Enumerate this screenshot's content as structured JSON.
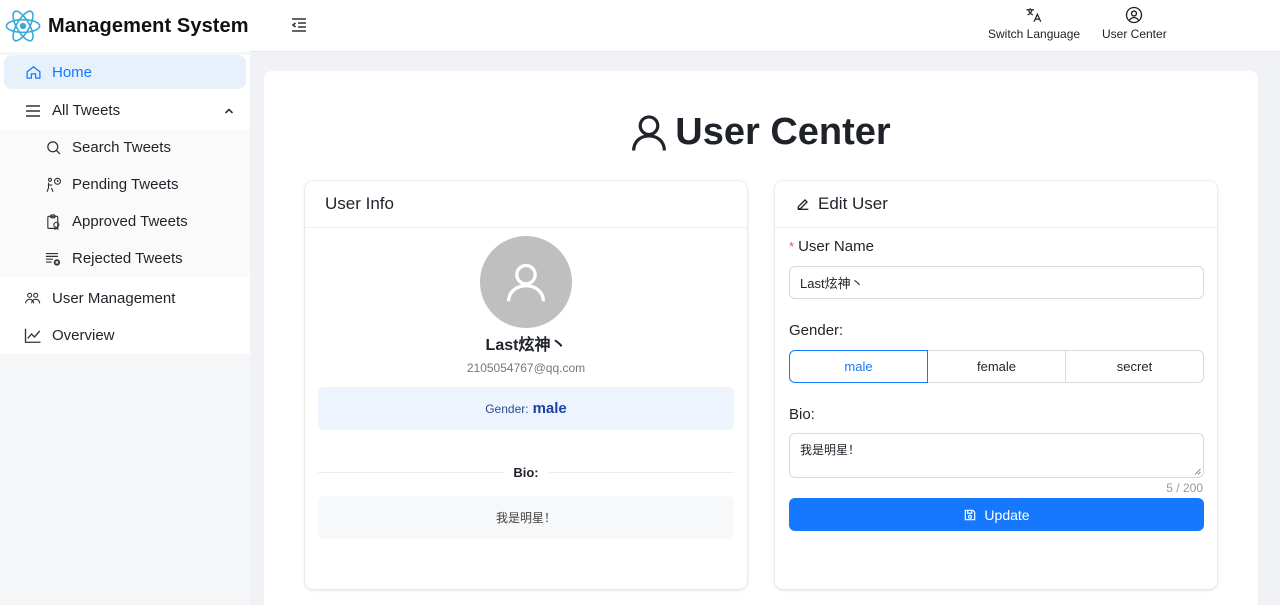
{
  "app": {
    "title": "Management System"
  },
  "sidebar": {
    "items": [
      {
        "label": "Home",
        "icon": "home-icon",
        "active": true
      },
      {
        "label": "All Tweets",
        "icon": "menu-lines-icon",
        "expanded": true,
        "children": [
          {
            "label": "Search Tweets",
            "icon": "search-icon"
          },
          {
            "label": "Pending Tweets",
            "icon": "pending-icon"
          },
          {
            "label": "Approved Tweets",
            "icon": "approved-icon"
          },
          {
            "label": "Rejected Tweets",
            "icon": "rejected-icon"
          }
        ]
      },
      {
        "label": "User Management",
        "icon": "users-icon"
      },
      {
        "label": "Overview",
        "icon": "chart-line-icon"
      }
    ]
  },
  "header": {
    "switch_language": "Switch Language",
    "user_center": "User Center"
  },
  "page": {
    "title": "User Center"
  },
  "user_info": {
    "title": "User Info",
    "name": "Last炫神丶",
    "email": "2105054767@qq.com",
    "gender_label": "Gender:",
    "gender_value": "male",
    "bio_label": "Bio:",
    "bio_value": "我是明星！"
  },
  "edit_user": {
    "title": "Edit User",
    "username_label": "User Name",
    "username_value": "Last炫神丶",
    "gender_label": "Gender:",
    "gender_options": [
      "male",
      "female",
      "secret"
    ],
    "gender_selected": "male",
    "bio_label": "Bio:",
    "bio_value": "我是明星！",
    "bio_counter": "5 / 200",
    "update_label": "Update"
  },
  "colors": {
    "primary": "#1677ff",
    "active_bg": "#e6f1fc",
    "avatar_bg": "#bfbfbf"
  }
}
